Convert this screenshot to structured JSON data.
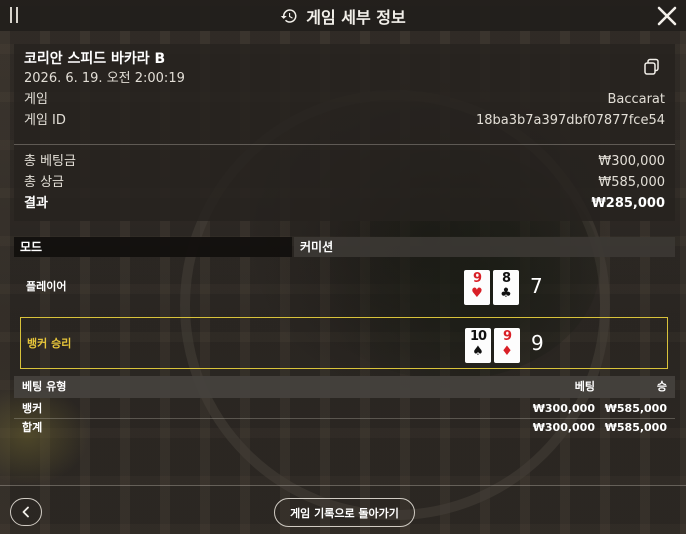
{
  "header": {
    "title": "게임 세부 정보"
  },
  "info": {
    "game_name": "코리안 스피드 바카라 B",
    "datetime": "2026. 6. 19. 오전 2:00:19",
    "game_label": "게임",
    "game_value": "Baccarat",
    "id_label": "게임 ID",
    "id_value": "18ba3b7a397dbf07877fce54"
  },
  "totals": {
    "bet_label": "총 베팅금",
    "bet_value": "₩300,000",
    "win_label": "총 상금",
    "win_value": "₩585,000",
    "result_label": "결과",
    "result_value": "₩285,000"
  },
  "mode": {
    "label": "모드",
    "value": "커미션"
  },
  "player": {
    "label": "플레이어",
    "cards": [
      {
        "rank": "9",
        "suit": "♥",
        "color": "red"
      },
      {
        "rank": "8",
        "suit": "♣",
        "color": "black"
      }
    ],
    "score": "7"
  },
  "banker": {
    "label": "뱅커 승리",
    "cards": [
      {
        "rank": "10",
        "suit": "♠",
        "color": "black"
      },
      {
        "rank": "9",
        "suit": "♦",
        "color": "red"
      }
    ],
    "score": "9",
    "highlight_color": "#d8c23a"
  },
  "bets": {
    "headers": {
      "type": "베팅 유형",
      "bet": "베팅",
      "win": "승"
    },
    "rows": [
      {
        "type": "뱅커",
        "bet": "₩300,000",
        "win": "₩585,000"
      },
      {
        "type": "합계",
        "bet": "₩300,000",
        "win": "₩585,000"
      }
    ]
  },
  "footer": {
    "history_button": "게임 기록으로 돌아가기"
  },
  "icons": {
    "history": "history-icon",
    "close": "close-icon",
    "copy": "copy-icon",
    "back": "chevron-left-icon",
    "drag": "drag-handle-icon"
  }
}
